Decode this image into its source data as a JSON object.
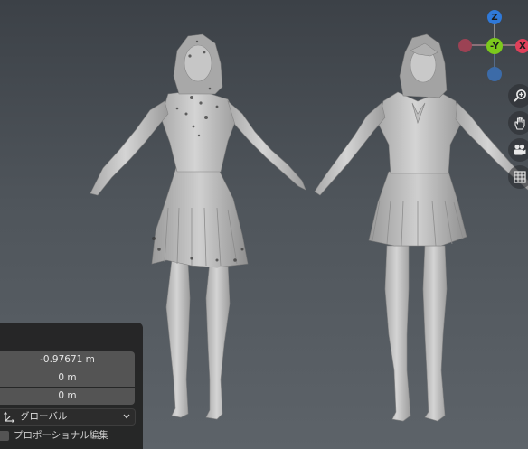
{
  "viewport": {
    "background_top": "#3c4147",
    "background_bottom": "#5d6369",
    "model_color": "#c8c8c8"
  },
  "gizmo": {
    "z_label": "Z",
    "y_label": "-Y",
    "x_label": "X",
    "z_color": "#2f79d9",
    "y_color": "#7cc91c",
    "x_color": "#e0405a",
    "neg_x_color": "#9c4254",
    "neg_z_color": "#3c6ba8"
  },
  "nav_buttons": {
    "zoom_icon": "zoom-icon",
    "pan_icon": "hand-icon",
    "camera_icon": "camera-icon",
    "ortho_icon": "grid-icon"
  },
  "operator_panel": {
    "x_value": "-0.97671 m",
    "y_value": "0 m",
    "z_value": "0 m",
    "orientation_value": "グローバル",
    "proportional_label": "プロポーショナル編集",
    "proportional_checked": false
  }
}
